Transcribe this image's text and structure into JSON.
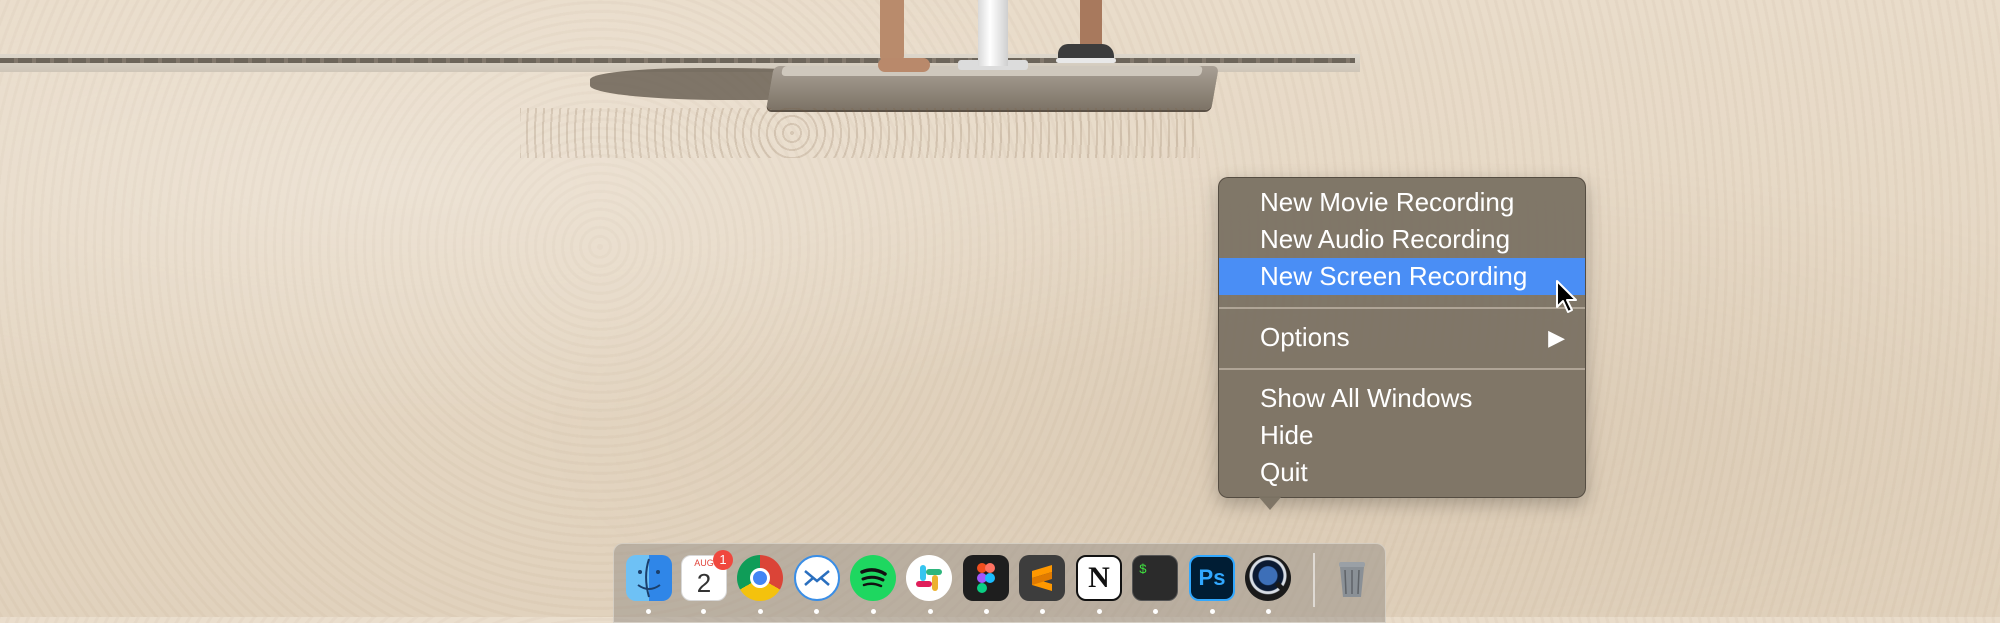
{
  "context_menu": {
    "items": [
      {
        "label": "New Movie Recording"
      },
      {
        "label": "New Audio Recording"
      },
      {
        "label": "New Screen Recording",
        "highlighted": true
      },
      {
        "label": "Options",
        "submenu_arrow": "▶"
      },
      {
        "label": "Show All Windows"
      },
      {
        "label": "Hide"
      },
      {
        "label": "Quit"
      }
    ],
    "highlight_color": "#4a8ef5"
  },
  "dock": {
    "calendar": {
      "month": "AUG",
      "day": "2",
      "badge": "1"
    },
    "icons": [
      {
        "name": "finder-icon"
      },
      {
        "name": "calendar-icon"
      },
      {
        "name": "chrome-icon"
      },
      {
        "name": "airmail-icon"
      },
      {
        "name": "spotify-icon"
      },
      {
        "name": "slack-icon"
      },
      {
        "name": "figma-icon"
      },
      {
        "name": "sublime-text-icon"
      },
      {
        "name": "notion-icon",
        "glyph": "N"
      },
      {
        "name": "terminal-icon",
        "glyph": "$"
      },
      {
        "name": "photoshop-icon",
        "glyph": "Ps"
      },
      {
        "name": "quicktime-icon"
      },
      {
        "name": "trash-icon"
      }
    ]
  }
}
